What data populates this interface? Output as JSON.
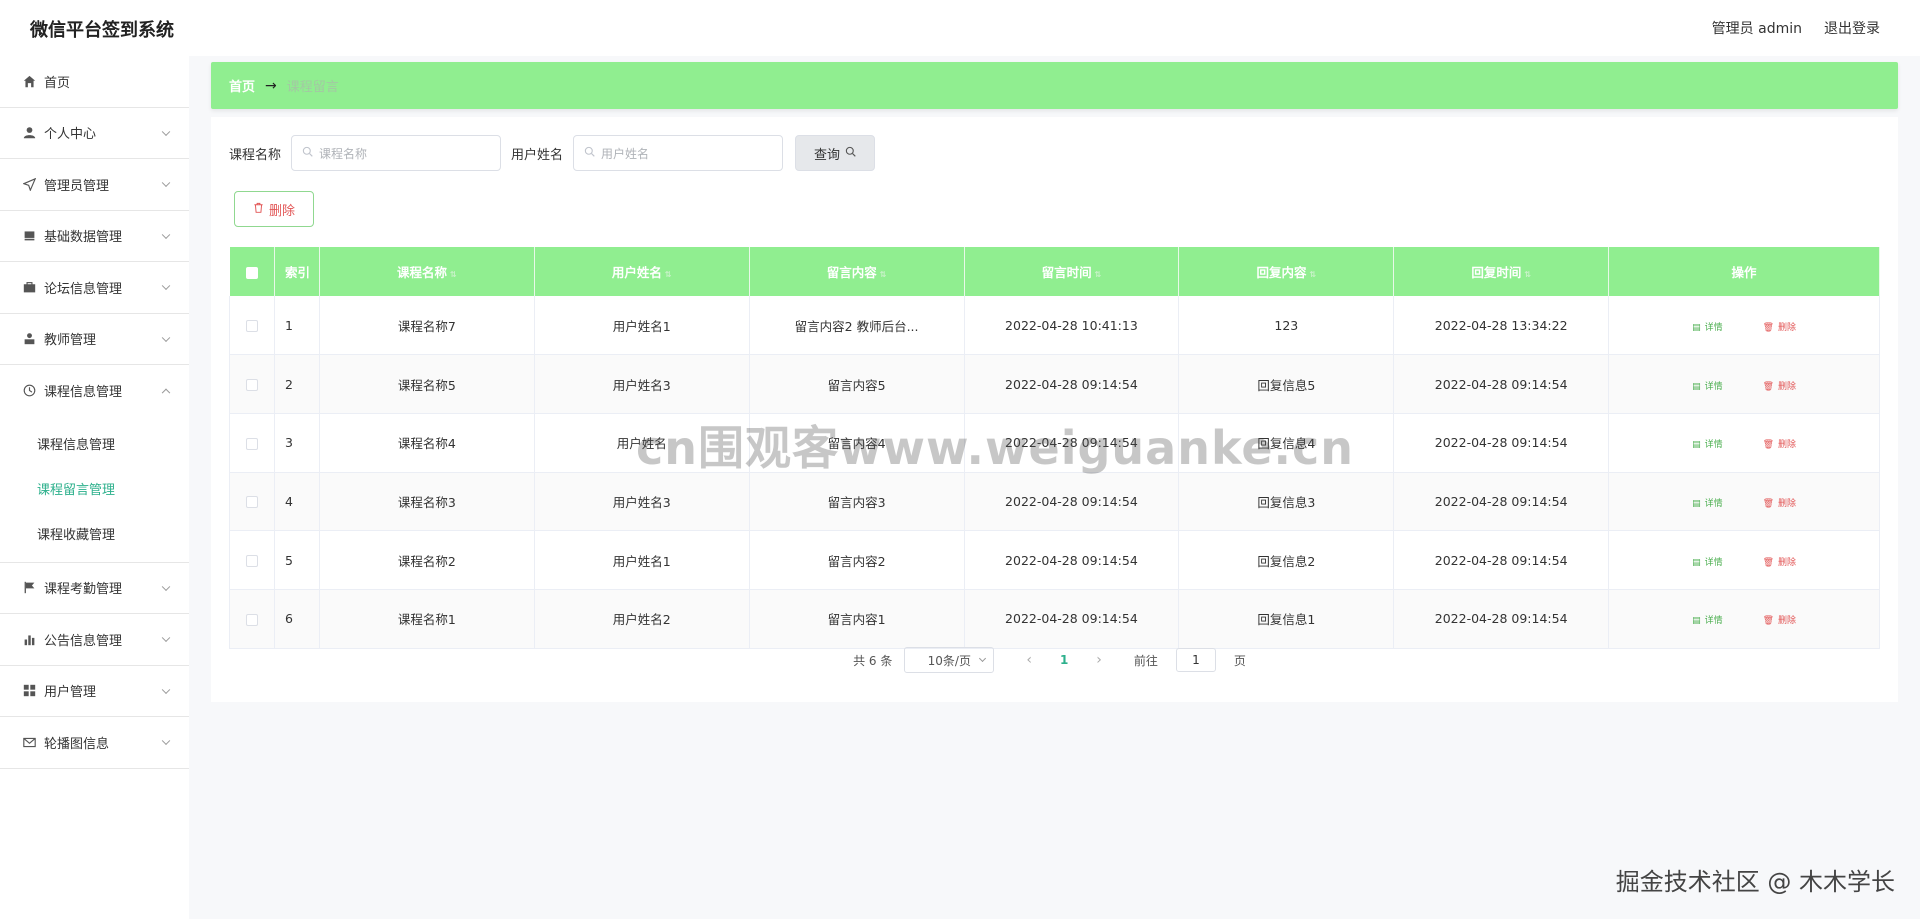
{
  "app": {
    "title": "微信平台签到系统",
    "admin_label": "管理员 admin",
    "logout_label": "退出登录"
  },
  "sidebar": {
    "items": [
      {
        "label": "首页",
        "icon": "home-icon"
      },
      {
        "label": "个人中心",
        "icon": "user-icon"
      },
      {
        "label": "管理员管理",
        "icon": "send-icon"
      },
      {
        "label": "基础数据管理",
        "icon": "stack-icon"
      },
      {
        "label": "论坛信息管理",
        "icon": "briefcase-icon"
      },
      {
        "label": "教师管理",
        "icon": "teacher-icon"
      },
      {
        "label": "课程信息管理",
        "icon": "clock-icon"
      },
      {
        "label": "课程考勤管理",
        "icon": "flag-icon"
      },
      {
        "label": "公告信息管理",
        "icon": "bar-chart-icon"
      },
      {
        "label": "用户管理",
        "icon": "grid-icon"
      },
      {
        "label": "轮播图信息",
        "icon": "mail-icon"
      }
    ],
    "submenu": [
      {
        "label": "课程信息管理",
        "active": false
      },
      {
        "label": "课程留言管理",
        "active": true
      },
      {
        "label": "课程收藏管理",
        "active": false
      }
    ]
  },
  "breadcrumb": {
    "home": "首页",
    "separator": "→",
    "current": "课程留言"
  },
  "search": {
    "course_label": "课程名称",
    "course_placeholder": "课程名称",
    "user_label": "用户姓名",
    "user_placeholder": "用户姓名",
    "query_label": "查询"
  },
  "actions": {
    "delete_label": "删除"
  },
  "table": {
    "headers": {
      "index": "索引",
      "course": "课程名称",
      "user": "用户姓名",
      "message": "留言内容",
      "message_time": "留言时间",
      "reply": "回复内容",
      "reply_time": "回复时间",
      "ops": "操作"
    },
    "detail_label": "详情",
    "delete_label": "删除",
    "rows": [
      {
        "index": "1",
        "course": "课程名称7",
        "user": "用户姓名1",
        "message": "留言内容2 教师后台...",
        "message_time": "2022-04-28 10:41:13",
        "reply": "123",
        "reply_time": "2022-04-28 13:34:22"
      },
      {
        "index": "2",
        "course": "课程名称5",
        "user": "用户姓名3",
        "message": "留言内容5",
        "message_time": "2022-04-28 09:14:54",
        "reply": "回复信息5",
        "reply_time": "2022-04-28 09:14:54"
      },
      {
        "index": "3",
        "course": "课程名称4",
        "user": "用户姓名",
        "message": "留言内容4",
        "message_time": "2022-04-28 09:14:54",
        "reply": "回复信息4",
        "reply_time": "2022-04-28 09:14:54"
      },
      {
        "index": "4",
        "course": "课程名称3",
        "user": "用户姓名3",
        "message": "留言内容3",
        "message_time": "2022-04-28 09:14:54",
        "reply": "回复信息3",
        "reply_time": "2022-04-28 09:14:54"
      },
      {
        "index": "5",
        "course": "课程名称2",
        "user": "用户姓名1",
        "message": "留言内容2",
        "message_time": "2022-04-28 09:14:54",
        "reply": "回复信息2",
        "reply_time": "2022-04-28 09:14:54"
      },
      {
        "index": "6",
        "course": "课程名称1",
        "user": "用户姓名2",
        "message": "留言内容1",
        "message_time": "2022-04-28 09:14:54",
        "reply": "回复信息1",
        "reply_time": "2022-04-28 09:14:54"
      }
    ]
  },
  "pagination": {
    "total": "共 6 条",
    "page_size": "10条/页",
    "current_page": "1",
    "goto_prefix": "前往",
    "goto_value": "1",
    "goto_suffix": "页"
  },
  "watermarks": {
    "center": "cn围观客www.weiguanke.cn",
    "corner": "掘金技术社区 @ 木木学长"
  },
  "colors": {
    "accent_green": "#90ee90",
    "active_text": "#2db08c",
    "danger": "#e25555"
  }
}
